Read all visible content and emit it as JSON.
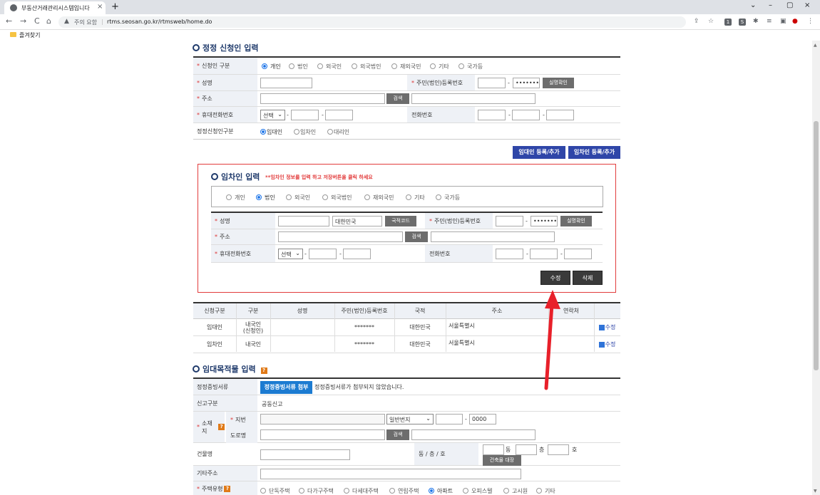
{
  "browser": {
    "tab_title": "부동산거래관리시스템입니다",
    "tab_close": "×",
    "new_tab": "+",
    "security_label": "주의 요함",
    "url": "rtms.seosan.go.kr/rtmsweb/home.do",
    "bookmark_label": "즐겨찾기",
    "nav_back": "←",
    "nav_forward": "→",
    "nav_reload": "C",
    "nav_home": "⌂",
    "win_min": "–",
    "win_max": "▢",
    "win_close": "×"
  },
  "correction_applicant": {
    "title": "정정 신청인 입력",
    "type_label": "신청인 구분",
    "type_options": [
      "개인",
      "법인",
      "외국인",
      "외국법인",
      "재외국민",
      "기타",
      "국가등"
    ],
    "type_selected": "개인",
    "name_label": "성명",
    "reg_no_label": "주민(법인)등록번호",
    "reg_no_value": "•••••••",
    "verify_button": "실명확인",
    "address_label": "주소",
    "search_button": "검색",
    "mobile_label": "휴대전화번호",
    "mobile_select": "선택",
    "phone_label": "전화번호",
    "correction_type_label": "정정신청인구분",
    "correction_type_options": [
      "임대인",
      "임차인",
      "대리인"
    ],
    "correction_type_selected": "임대인",
    "add_landlord_button": "임대인 등록/추가",
    "add_tenant_button": "임차인 등록/추가"
  },
  "tenant_input": {
    "title": "임차인 입력",
    "notice": "**임차인 정보를 입력 하고 저장버튼을 클릭 하세요",
    "type_options": [
      "개인",
      "법인",
      "외국인",
      "외국법인",
      "재외국민",
      "기타",
      "국가등"
    ],
    "type_selected": "법인",
    "name_label": "성명",
    "nationality_value": "대한민국",
    "nationality_button": "국적코드",
    "reg_no_label": "주민(법인)등록번호",
    "reg_no_value": "•••••••",
    "verify_button": "실명확인",
    "address_label": "주소",
    "search_button": "검색",
    "mobile_label": "휴대전화번호",
    "mobile_select": "선택",
    "phone_label": "전화번호",
    "modify_button": "수정",
    "delete_button": "삭제"
  },
  "parties_table": {
    "headers": [
      "신청구분",
      "구분",
      "성명",
      "주민(법인)등록번호",
      "국적",
      "주소",
      "연락처",
      ""
    ],
    "rows": [
      {
        "role": "임대인",
        "kind_line1": "내국인",
        "kind_line2": "(신청인)",
        "name": "",
        "reg_no": "*******",
        "nation": "대한민국",
        "address": "서울특별시",
        "contact": "",
        "action": "수정"
      },
      {
        "role": "임차인",
        "kind_line1": "내국인",
        "kind_line2": "",
        "name": "",
        "reg_no": "*******",
        "nation": "대한민국",
        "address": "서울특별시",
        "contact": "",
        "action": "수정"
      }
    ]
  },
  "lease_target": {
    "title": "임대목적물 입력",
    "docs_label": "정정증빙서류",
    "docs_button": "정정증빙서류 첨부",
    "docs_status": "정정증빙서류가 첨부되지 않았습니다.",
    "report_type_label": "신고구분",
    "report_type_value": "공동신고",
    "location_label": "소재지",
    "lot_label": "지번",
    "lot_select": "일반번지",
    "lot_sub_value": "0000",
    "road_label": "도로명",
    "search_button": "검색",
    "building_label": "건물명",
    "dong_ho_label": "동 / 층 / 호",
    "dong_unit": "동",
    "floor_unit": "층",
    "ho_unit": "호",
    "register_button": "건축물 대장",
    "other_address_label": "기타주소",
    "housing_type_label": "주택유형",
    "housing_options": [
      "단독주택",
      "다가구주택",
      "다세대주택",
      "연립주택",
      "아파트",
      "오피스텔",
      "고시원",
      "기타"
    ],
    "housing_selected": "아파트"
  },
  "colors": {
    "accent_blue": "#2f46a8",
    "title_navy": "#1f3a6b",
    "highlight_red": "#e23c3c",
    "arrow_red": "#e8202a"
  }
}
